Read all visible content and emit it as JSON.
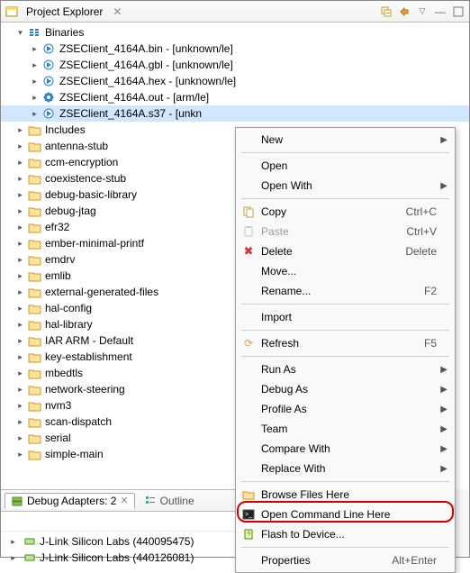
{
  "header": {
    "title": "Project Explorer"
  },
  "tree": {
    "binaries": "Binaries",
    "bin_items": [
      "ZSEClient_4164A.bin - [unknown/le]",
      "ZSEClient_4164A.gbl - [unknown/le]",
      "ZSEClient_4164A.hex - [unknown/le]",
      "ZSEClient_4164A.out - [arm/le]"
    ],
    "bin_sel_name": "ZSEClient_4164A.s37 - [unkn",
    "folders": [
      "Includes",
      "antenna-stub",
      "ccm-encryption",
      "coexistence-stub",
      "debug-basic-library",
      "debug-jtag",
      "efr32",
      "ember-minimal-printf",
      "emdrv",
      "emlib",
      "external-generated-files",
      "hal-config",
      "hal-library",
      "IAR ARM - Default",
      "key-establishment",
      "mbedtls",
      "network-steering",
      "nvm3",
      "scan-dispatch",
      "serial",
      "simple-main"
    ]
  },
  "debug": {
    "tab_label": "Debug Adapters: 2",
    "outline_label": "Outline",
    "adapters": [
      "J-Link Silicon Labs (440095475)",
      "J-Link Silicon Labs (440126081)"
    ]
  },
  "ctx": {
    "new": "New",
    "open": "Open",
    "open_with": "Open With",
    "copy": "Copy",
    "copy_k": "Ctrl+C",
    "paste": "Paste",
    "paste_k": "Ctrl+V",
    "delete": "Delete",
    "delete_k": "Delete",
    "move": "Move...",
    "rename": "Rename...",
    "rename_k": "F2",
    "import": "Import",
    "refresh": "Refresh",
    "refresh_k": "F5",
    "run_as": "Run As",
    "debug_as": "Debug As",
    "profile_as": "Profile As",
    "team": "Team",
    "compare_with": "Compare With",
    "replace_with": "Replace With",
    "browse": "Browse Files Here",
    "cmdline": "Open Command Line Here",
    "flash": "Flash to Device...",
    "properties": "Properties",
    "properties_k": "Alt+Enter"
  }
}
